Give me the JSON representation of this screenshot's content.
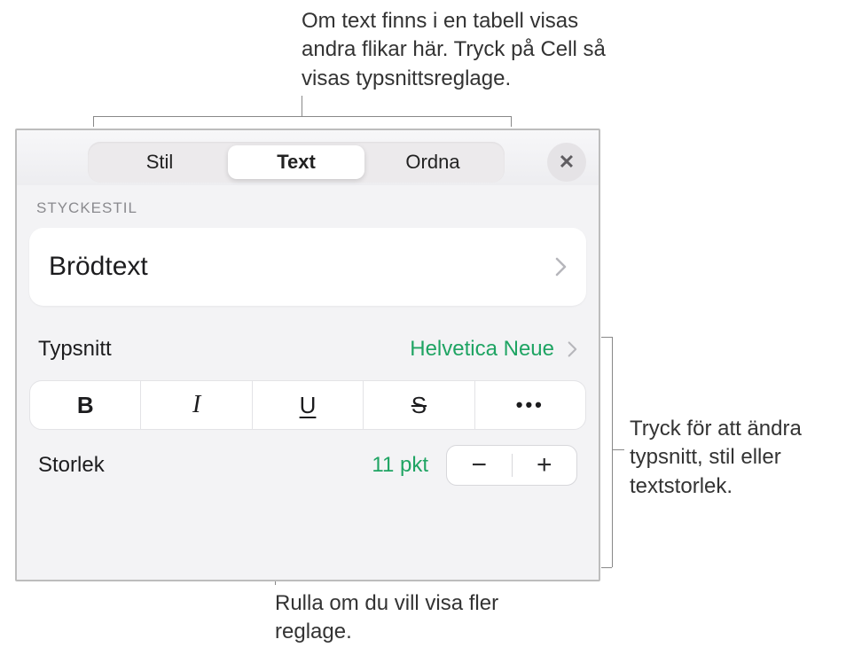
{
  "callouts": {
    "top": "Om text finns i en tabell visas andra flikar här. Tryck på Cell så visas typsnittsreglage.",
    "right": "Tryck för att ändra typsnitt, stil eller textstorlek.",
    "bottom": "Rulla om du vill visa fler reglage."
  },
  "tabs": {
    "items": [
      "Stil",
      "Text",
      "Ordna"
    ],
    "active": 1
  },
  "paragraph_style": {
    "section_label": "STYCKESTIL",
    "value": "Brödtext"
  },
  "font": {
    "label": "Typsnitt",
    "value": "Helvetica Neue"
  },
  "style_buttons": {
    "bold": "B",
    "italic": "I",
    "underline": "U",
    "strike": "S",
    "more": "•••"
  },
  "size": {
    "label": "Storlek",
    "value": "11 pkt",
    "minus": "−",
    "plus": "+"
  },
  "icons": {
    "close": "✕"
  }
}
